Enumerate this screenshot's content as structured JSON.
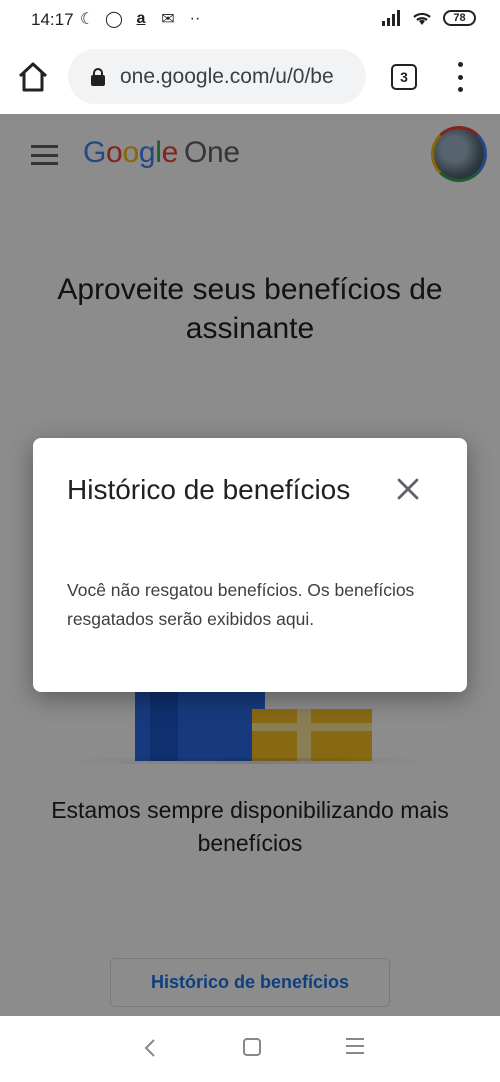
{
  "status_bar": {
    "time": "14:17",
    "battery": "78",
    "icons_left": [
      "moon-icon",
      "whatsapp-icon",
      "amazon-icon",
      "outlook-icon",
      "more-icon"
    ],
    "icons_right": [
      "signal-icon",
      "wifi-icon",
      "battery-icon"
    ]
  },
  "browser": {
    "url": "one.google.com/u/0/be",
    "tab_count": "3"
  },
  "app": {
    "logo_google": "Google",
    "logo_one": "One"
  },
  "page": {
    "hero_title": "Aproveite seus benefícios de assinante",
    "subtitle": "Estamos sempre disponibilizando mais benefícios",
    "history_button": "Histórico de benefícios"
  },
  "dialog": {
    "title": "Histórico de benefícios",
    "body": "Você não resgatou benefícios. Os benefícios resgatados serão exibidos aqui."
  },
  "colors": {
    "google_blue": "#4285F4",
    "google_red": "#EA4335",
    "google_yellow": "#FBBC05",
    "google_green": "#34A853",
    "link_blue": "#1A73E8"
  }
}
